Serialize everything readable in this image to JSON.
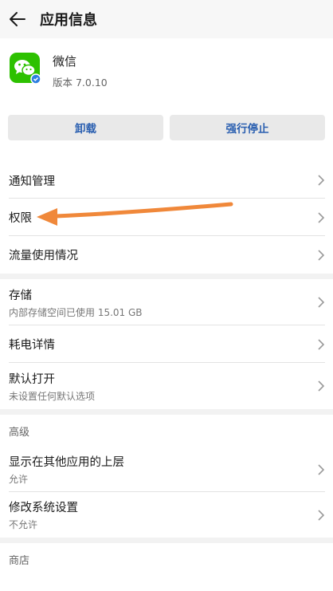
{
  "header": {
    "title": "应用信息",
    "back_icon": "back-arrow-icon"
  },
  "app": {
    "name": "微信",
    "version": "版本 7.0.10",
    "icon": "wechat-icon"
  },
  "actions": {
    "uninstall": "卸载",
    "force_stop": "强行停止"
  },
  "section1": [
    {
      "label": "通知管理"
    },
    {
      "label": "权限"
    },
    {
      "label": "流量使用情况"
    }
  ],
  "section2": [
    {
      "label": "存储",
      "sub": "内部存储空间已使用 15.01 GB"
    },
    {
      "label": "耗电详情"
    },
    {
      "label": "默认打开",
      "sub": "未设置任何默认选项"
    }
  ],
  "advanced": {
    "title": "高级",
    "items": [
      {
        "label": "显示在其他应用的上层",
        "sub": "允许"
      },
      {
        "label": "修改系统设置",
        "sub": "不允许"
      }
    ]
  },
  "store": {
    "title": "商店"
  },
  "colors": {
    "accent": "#2a5fb0",
    "arrow": "#f0883a",
    "wechat": "#2dc100"
  }
}
